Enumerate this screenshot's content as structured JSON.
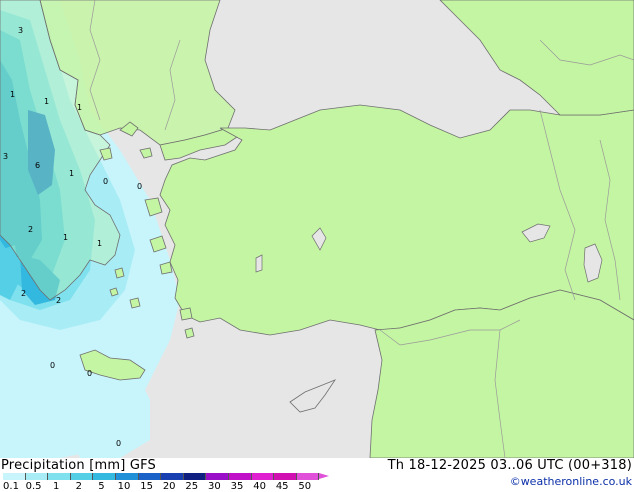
{
  "title": {
    "product": "Precipitation [mm]",
    "model": "GFS",
    "valid_time": "Th 18-12-2025 03..06 UTC (00+318)"
  },
  "credit": "©weatheronline.co.uk",
  "colors": {
    "sea": "#e6e6e6",
    "land": "#c4f5a2",
    "coast": "#6f6f6f",
    "border": "#9a9a9a",
    "lake": "#e6e6e6"
  },
  "legend": {
    "ticks": [
      "0.1",
      "0.5",
      "1",
      "2",
      "5",
      "10",
      "15",
      "20",
      "25",
      "30",
      "35",
      "40",
      "45",
      "50"
    ],
    "colors": [
      "#c8f5fb",
      "#a8ecf5",
      "#7fe0ee",
      "#55cfe6",
      "#33b8e0",
      "#2090d8",
      "#1a62c8",
      "#1840b0",
      "#102080",
      "#9a10c8",
      "#c010c8",
      "#e020d0",
      "#d010b0",
      "#e050d8"
    ]
  },
  "contour_labels": [
    "3",
    "1",
    "1",
    "1",
    "3",
    "6",
    "1",
    "0",
    "0",
    "2",
    "1",
    "1",
    "2",
    "2",
    "0",
    "0",
    "0"
  ]
}
